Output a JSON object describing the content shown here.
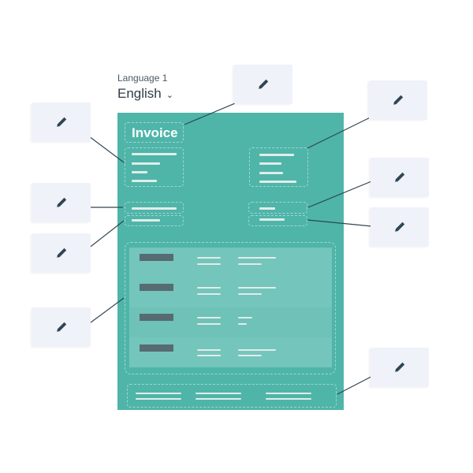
{
  "language": {
    "label": "Language 1",
    "selected": "English",
    "chevron_icon": "chevron-down-icon"
  },
  "invoice": {
    "title": "Invoice",
    "background_color": "#4fb5a9"
  },
  "edit_cards": [
    {
      "id": "title",
      "icon": "pencil-icon"
    },
    {
      "id": "sender-address",
      "icon": "pencil-icon"
    },
    {
      "id": "invoice-number",
      "icon": "pencil-icon"
    },
    {
      "id": "invoice-date",
      "icon": "pencil-icon"
    },
    {
      "id": "line-items",
      "icon": "pencil-icon"
    },
    {
      "id": "recipient-address",
      "icon": "pencil-icon"
    },
    {
      "id": "due-field",
      "icon": "pencil-icon"
    },
    {
      "id": "amount-field",
      "icon": "pencil-icon"
    },
    {
      "id": "footer",
      "icon": "pencil-icon"
    }
  ],
  "colors": {
    "card_bg": "#eff2f9",
    "icon": "#2f4654",
    "connector": "#2f4654"
  }
}
